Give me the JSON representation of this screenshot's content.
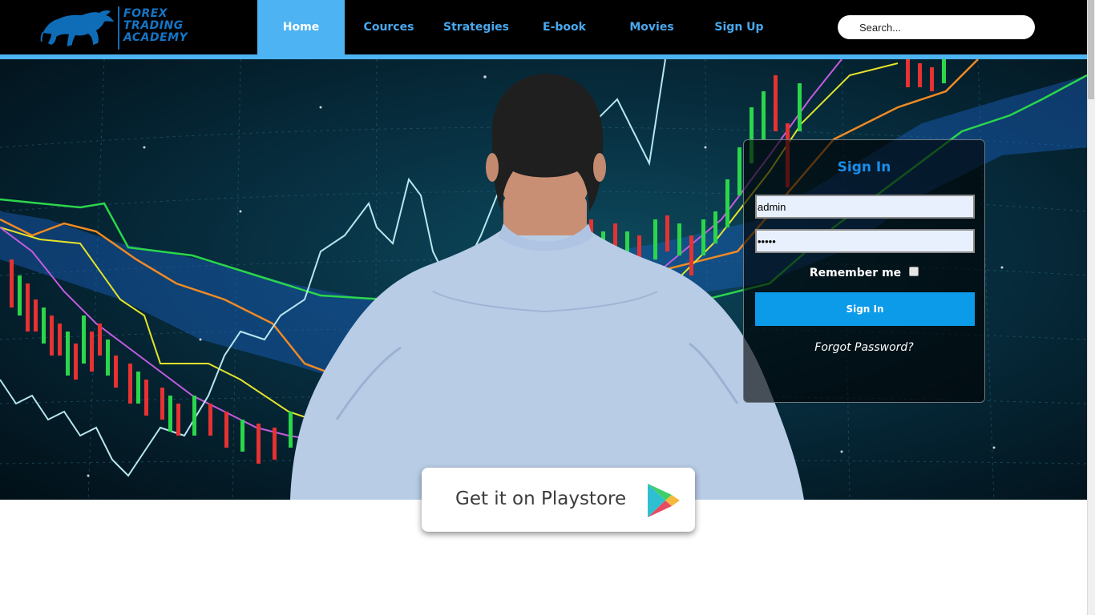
{
  "brand": {
    "line1": "FOREX",
    "line2": "TRADING",
    "line3": "ACADEMY",
    "color": "#1575c6"
  },
  "nav": {
    "items": [
      {
        "label": "Home",
        "active": true
      },
      {
        "label": "Cources",
        "active": false
      },
      {
        "label": "Strategies",
        "active": false
      },
      {
        "label": "E-book",
        "active": false
      },
      {
        "label": "Movies",
        "active": false
      },
      {
        "label": "Sign Up",
        "active": false
      }
    ],
    "accent_color": "#4db3f2",
    "link_color": "#4aa8ee"
  },
  "search": {
    "placeholder": "Search...",
    "icon": "search-icon"
  },
  "signin": {
    "title": "Sign In",
    "username_value": "admin",
    "password_value": "admin",
    "remember_label": "Remember me",
    "remember_checked": false,
    "button_label": "Sign In",
    "forgot_label": "Forgot Password?",
    "button_color": "#0b9be8",
    "title_color": "#1a8ee8"
  },
  "playstore": {
    "label": "Get it on Playstore",
    "icon": "play-triangle-icon"
  },
  "hero": {
    "image": "trader-watching-candlestick-charts"
  }
}
